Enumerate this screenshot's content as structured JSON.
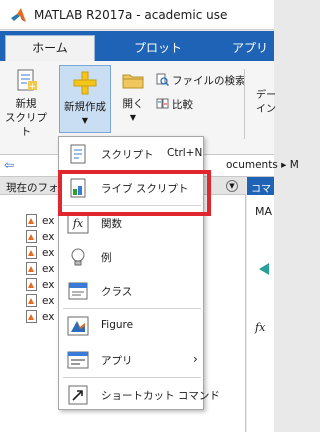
{
  "window": {
    "title": "MATLAB R2017a - academic use"
  },
  "tabs": [
    {
      "label": "ホーム",
      "active": true
    },
    {
      "label": "プロット",
      "active": false
    },
    {
      "label": "アプリ",
      "active": false
    }
  ],
  "ribbon": {
    "new_script": {
      "line1": "新規",
      "line2": "スクリプト"
    },
    "new_make": {
      "label": "新規作成",
      "arrow": "▼"
    },
    "open": {
      "label": "開く",
      "arrow": "▼"
    },
    "file_search": "ファイルの検索",
    "compare": "比較",
    "cut_line1": "デー",
    "cut_line2": "イン"
  },
  "path": {
    "crumb": "ocuments ▸ M"
  },
  "current_folder": {
    "header": "現在のフォ",
    "files": [
      "ex",
      "ex",
      "ex",
      "ex",
      "ex",
      "ex",
      "ex"
    ]
  },
  "right_panel": {
    "header": "コマ",
    "text": "MA",
    "fx": "fx"
  },
  "dropdown": {
    "items": [
      {
        "label": "スクリプト",
        "shortcut": "Ctrl+N",
        "icon": "script-icon"
      },
      {
        "label": "ライブ スクリプト",
        "shortcut": "",
        "icon": "live-script-icon"
      },
      {
        "label": "関数",
        "shortcut": "",
        "icon": "function-icon"
      },
      {
        "label": "例",
        "shortcut": "",
        "icon": "lightbulb-icon"
      },
      {
        "label": "クラス",
        "shortcut": "",
        "icon": "class-icon"
      },
      {
        "label": "Figure",
        "shortcut": "",
        "icon": "figure-icon"
      },
      {
        "label": "アプリ",
        "shortcut": "",
        "icon": "app-icon",
        "submenu": true
      },
      {
        "label": "ショートカット コマンド",
        "shortcut": "",
        "icon": "shortcut-icon"
      }
    ]
  },
  "colors": {
    "tab_blue": "#1e63b5",
    "highlight_red": "#e0262f"
  }
}
